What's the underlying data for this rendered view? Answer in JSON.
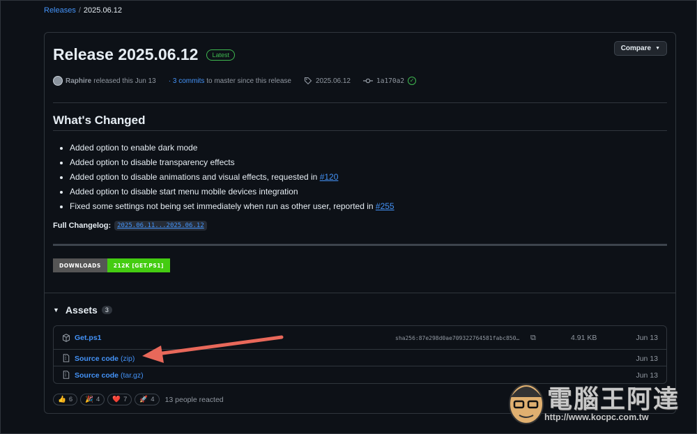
{
  "breadcrumb": {
    "parent": "Releases",
    "separator": "/",
    "current": "2025.06.12"
  },
  "release": {
    "title": "Release 2025.06.12",
    "badge": "Latest",
    "compare_label": "Compare",
    "author": "Raphire",
    "released_text": "released this Jun 13",
    "commits_prefix": "·",
    "commits_link": "3 commits",
    "commits_suffix": "to master since this release",
    "tag": "2025.06.12",
    "commit_hash": "1a170a2"
  },
  "notes": {
    "heading": "What's Changed",
    "items": [
      {
        "text": "Added option to enable dark mode",
        "ref": ""
      },
      {
        "text": "Added option to disable transparency effects",
        "ref": ""
      },
      {
        "text": "Added option to disable animations and visual effects, requested in ",
        "ref": "#120"
      },
      {
        "text": "Added option to disable start menu mobile devices integration",
        "ref": ""
      },
      {
        "text": "Fixed some settings not being set immediately when run as other user, reported in ",
        "ref": "#255"
      }
    ],
    "changelog_label": "Full Changelog:",
    "changelog_link": "2025.06.11...2025.06.12"
  },
  "downloads_badge": {
    "label": "DOWNLOADS",
    "value": "212K [GET.PS1]",
    "value_color": "#44cc11"
  },
  "assets": {
    "heading": "Assets",
    "count": "3",
    "rows": [
      {
        "name": "Get.ps1",
        "ext": "",
        "sha": "sha256:87e298d0ae709322764581fabc850…",
        "size": "4.91 KB",
        "date": "Jun 13"
      },
      {
        "name": "Source code",
        "ext": "(zip)",
        "sha": "",
        "size": "",
        "date": "Jun 13"
      },
      {
        "name": "Source code",
        "ext": "(tar.gz)",
        "sha": "",
        "size": "",
        "date": "Jun 13"
      }
    ]
  },
  "reactions": {
    "items": [
      {
        "emoji": "👍",
        "count": "6"
      },
      {
        "emoji": "🎉",
        "count": "4"
      },
      {
        "emoji": "❤️",
        "count": "7"
      },
      {
        "emoji": "🚀",
        "count": "4"
      }
    ],
    "summary": "13 people reacted"
  },
  "watermark": {
    "text": "電腦王阿達",
    "url": "http://www.kocpc.com.tw"
  }
}
